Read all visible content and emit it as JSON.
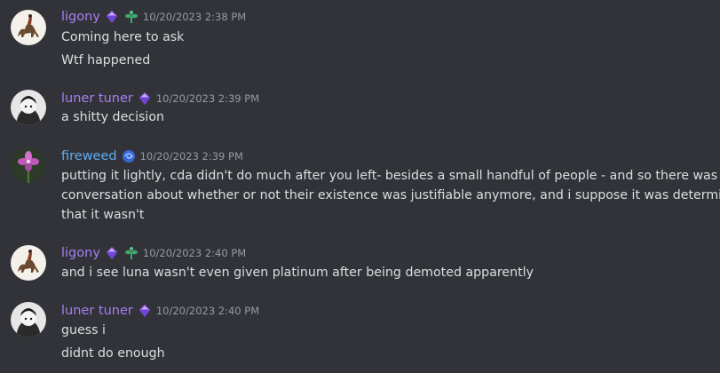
{
  "messages": [
    {
      "user": "ligony",
      "user_color": "#a77ff2",
      "timestamp": "10/20/2023 2:38 PM",
      "lines": [
        "Coming here to ask",
        "Wtf happened"
      ]
    },
    {
      "user": "luner tuner",
      "user_color": "#a77ff2",
      "timestamp": "10/20/2023 2:39 PM",
      "lines": [
        "a shitty decision"
      ]
    },
    {
      "user": "fireweed",
      "user_color": "#5eadf2",
      "timestamp": "10/20/2023 2:39 PM",
      "lines": [
        "putting it lightly, cda didn't do much after you left- besides a small handful of people - and so there was a",
        "conversation about whether or not their existence was justifiable anymore, and i suppose it was determined",
        "that it wasn't"
      ]
    },
    {
      "user": "ligony",
      "user_color": "#a77ff2",
      "timestamp": "10/20/2023 2:40 PM",
      "lines": [
        "and i see luna wasn't even given platinum after being demoted apparently"
      ]
    },
    {
      "user": "luner tuner",
      "user_color": "#a77ff2",
      "timestamp": "10/20/2023 2:40 PM",
      "lines": [
        "guess i",
        "didnt do enough"
      ]
    }
  ]
}
